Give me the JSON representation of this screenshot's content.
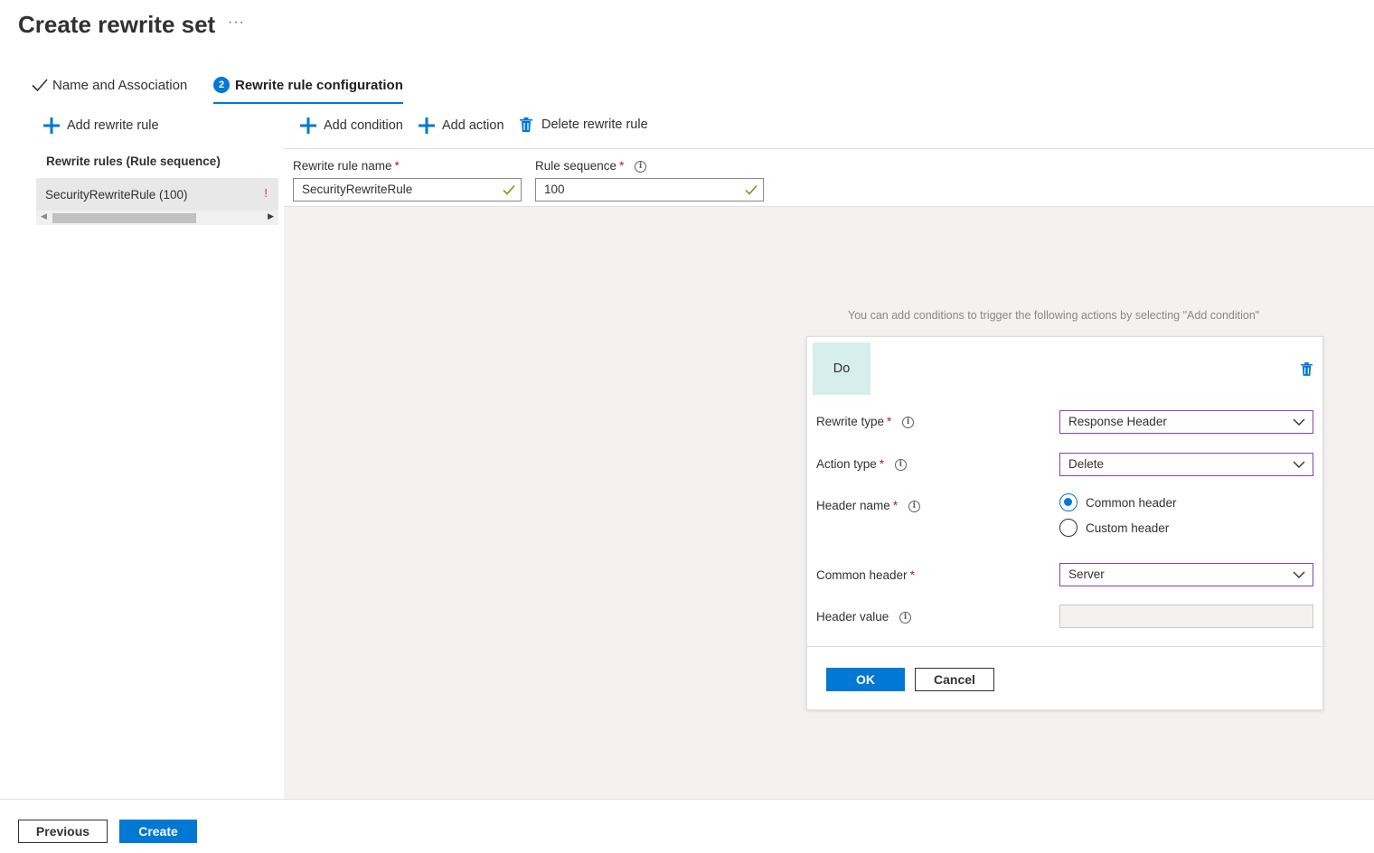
{
  "page": {
    "title": "Create rewrite set",
    "more_label": "···"
  },
  "wizard": {
    "steps": [
      {
        "label": "Name and Association",
        "status": "completed"
      },
      {
        "label": "Rewrite rule configuration",
        "number": "2",
        "status": "active"
      }
    ]
  },
  "left_panel": {
    "add_rule_label": "Add rewrite rule",
    "rules_heading": "Rewrite rules (Rule sequence)",
    "rules": [
      {
        "label": "SecurityRewriteRule (100)",
        "warning": "!"
      }
    ]
  },
  "toolbar": {
    "add_condition": "Add condition",
    "add_action": "Add action",
    "delete_rule": "Delete rewrite rule"
  },
  "rule_form": {
    "name_label": "Rewrite rule name",
    "name_value": "SecurityRewriteRule",
    "sequence_label": "Rule sequence",
    "sequence_value": "100",
    "required_marker": "*"
  },
  "hint": "You can add conditions to trigger the following actions by selecting \"Add condition\"",
  "action_card": {
    "tag": "Do",
    "rewrite_type_label": "Rewrite type",
    "rewrite_type_value": "Response Header",
    "action_type_label": "Action type",
    "action_type_value": "Delete",
    "header_name_label": "Header name",
    "header_name_options": [
      {
        "label": "Common header",
        "selected": true
      },
      {
        "label": "Custom header",
        "selected": false
      }
    ],
    "common_header_label": "Common header",
    "common_header_value": "Server",
    "header_value_label": "Header value",
    "header_value_value": "",
    "ok_label": "OK",
    "cancel_label": "Cancel"
  },
  "footer": {
    "previous_label": "Previous",
    "create_label": "Create"
  },
  "colors": {
    "accent": "#0078d4",
    "required": "#a4262c",
    "valid": "#57a300",
    "select_border": "#8a3fb5",
    "do_tag_bg": "#d7efec"
  }
}
